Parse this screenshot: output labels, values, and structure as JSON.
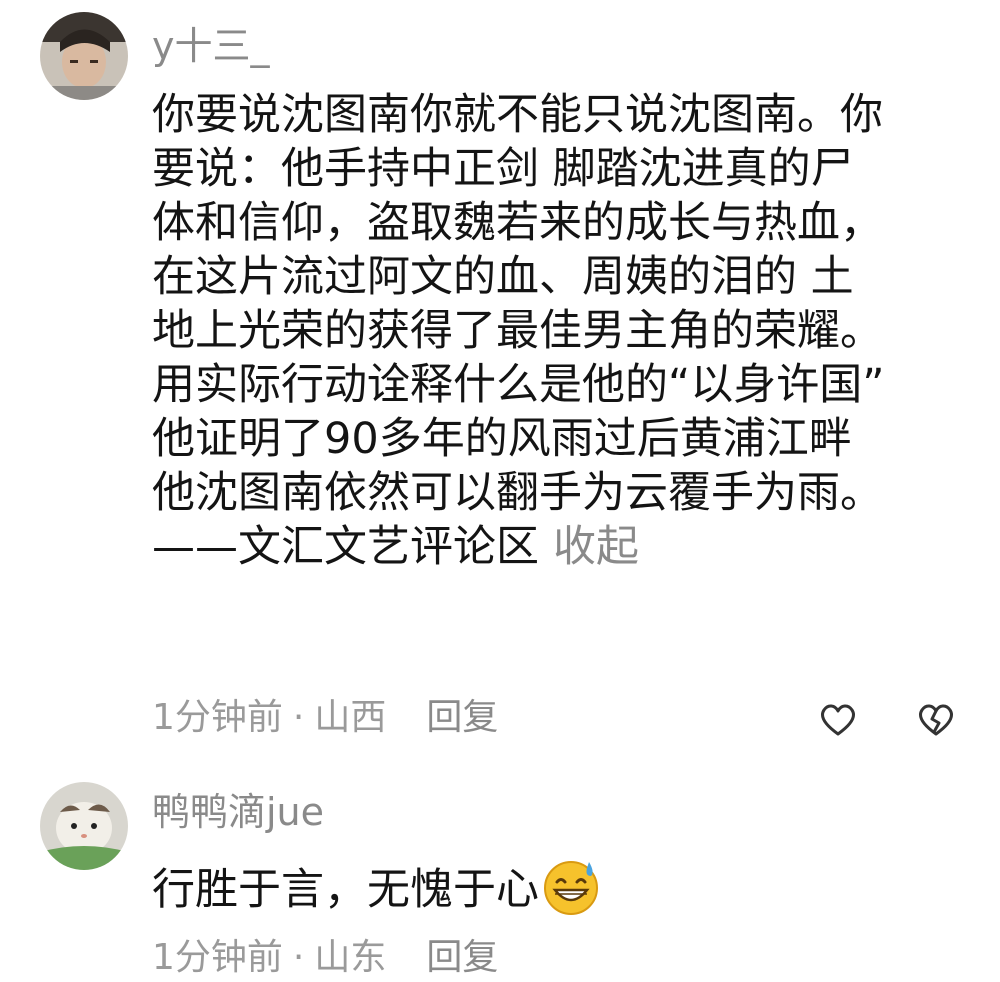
{
  "comments": [
    {
      "username": "y十三_",
      "lines": [
        "你要说沈图南你就不能只说沈图南。你",
        "要说：他手持中正剑 脚踏沈进真的尸",
        "体和信仰，盗取魏若来的成长与热血，",
        "在这片流过阿文的血、周姨的泪的 土",
        "地上光荣的获得了最佳男主角的荣耀。",
        "用实际行动诠释什么是他的“以身许国”",
        "他证明了90多年的风雨过后黄浦江畔",
        "他沈图南依然可以翻手为云覆手为雨。",
        "——文汇文艺评论区"
      ],
      "collapse_label": "收起",
      "time": "1分钟前",
      "separator": "·",
      "location": "山西",
      "reply_label": "回复",
      "icons": [
        "heart-icon",
        "broken-heart-icon"
      ]
    },
    {
      "username": "鸭鸭滴jue",
      "text": "行胜于言，无愧于心",
      "emoji": "grinning-sweat-emoji",
      "time": "1分钟前",
      "separator": "·",
      "location": "山东",
      "reply_label": "回复"
    }
  ],
  "colors": {
    "text": "#141414",
    "secondary": "#8a8a8a",
    "background": "#ffffff"
  }
}
